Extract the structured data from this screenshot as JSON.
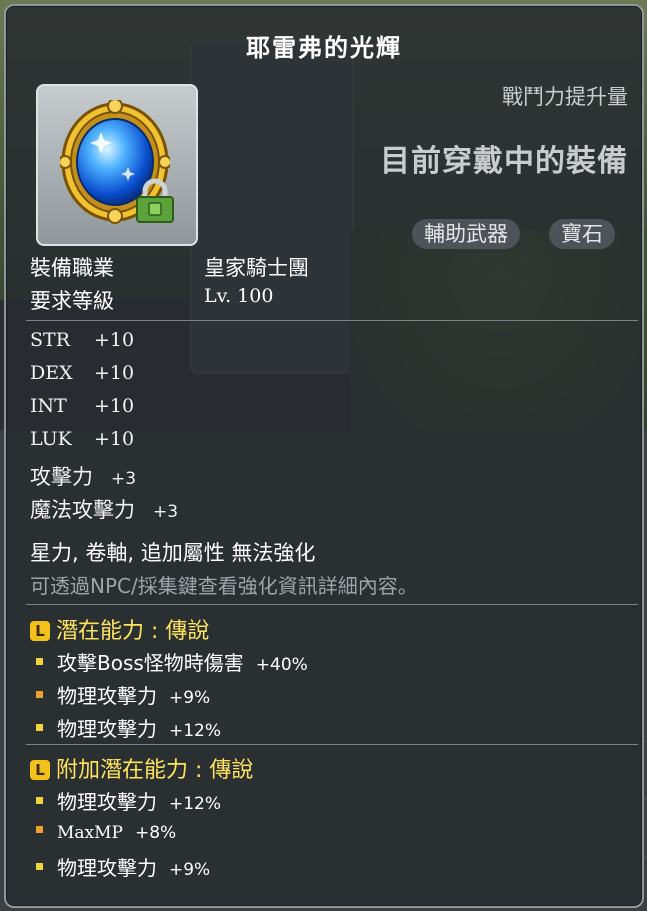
{
  "item": {
    "name": "耶雷弗的光輝",
    "combat_power_label": "戰鬥力提升量",
    "current_equipped": "目前穿戴中的裝備",
    "tags": [
      "輔助武器",
      "寶石"
    ]
  },
  "requirements": [
    {
      "label": "裝備職業",
      "value": "皇家騎士團"
    },
    {
      "label": "要求等級",
      "value": "Lv. 100"
    }
  ],
  "stats": [
    {
      "name": "STR",
      "value": "+10"
    },
    {
      "name": "DEX",
      "value": "+10"
    },
    {
      "name": "INT",
      "value": "+10"
    },
    {
      "name": "LUK",
      "value": "+10"
    },
    {
      "name": "攻擊力",
      "value": "+3"
    },
    {
      "name": "魔法攻擊力",
      "value": "+3"
    }
  ],
  "enhance_note": "星力, 卷軸, 追加屬性 無法強化",
  "hint": "可透過NPC/採集鍵查看強化資訊詳細內容。",
  "potential": {
    "badge": "L",
    "title": "潛在能力 : 傳說",
    "lines": [
      {
        "name": "攻擊Boss怪物時傷害",
        "value": "+40%"
      },
      {
        "name": "物理攻擊力",
        "value": "+9%"
      },
      {
        "name": "物理攻擊力",
        "value": "+12%"
      }
    ]
  },
  "bonus_potential": {
    "badge": "L",
    "title": "附加潛在能力 : 傳說",
    "lines": [
      {
        "name": "物理攻擊力",
        "value": "+12%"
      },
      {
        "name": "MaxMP",
        "value": "+8%"
      },
      {
        "name": "物理攻擊力",
        "value": "+9%"
      }
    ]
  },
  "colors": {
    "title": "#ffffff",
    "potential": "#ffe45a",
    "hint": "#9fa4a8",
    "panel": "#2c3034"
  },
  "icons": {
    "item": "blue-gem-icon",
    "lock": "lock-icon"
  }
}
